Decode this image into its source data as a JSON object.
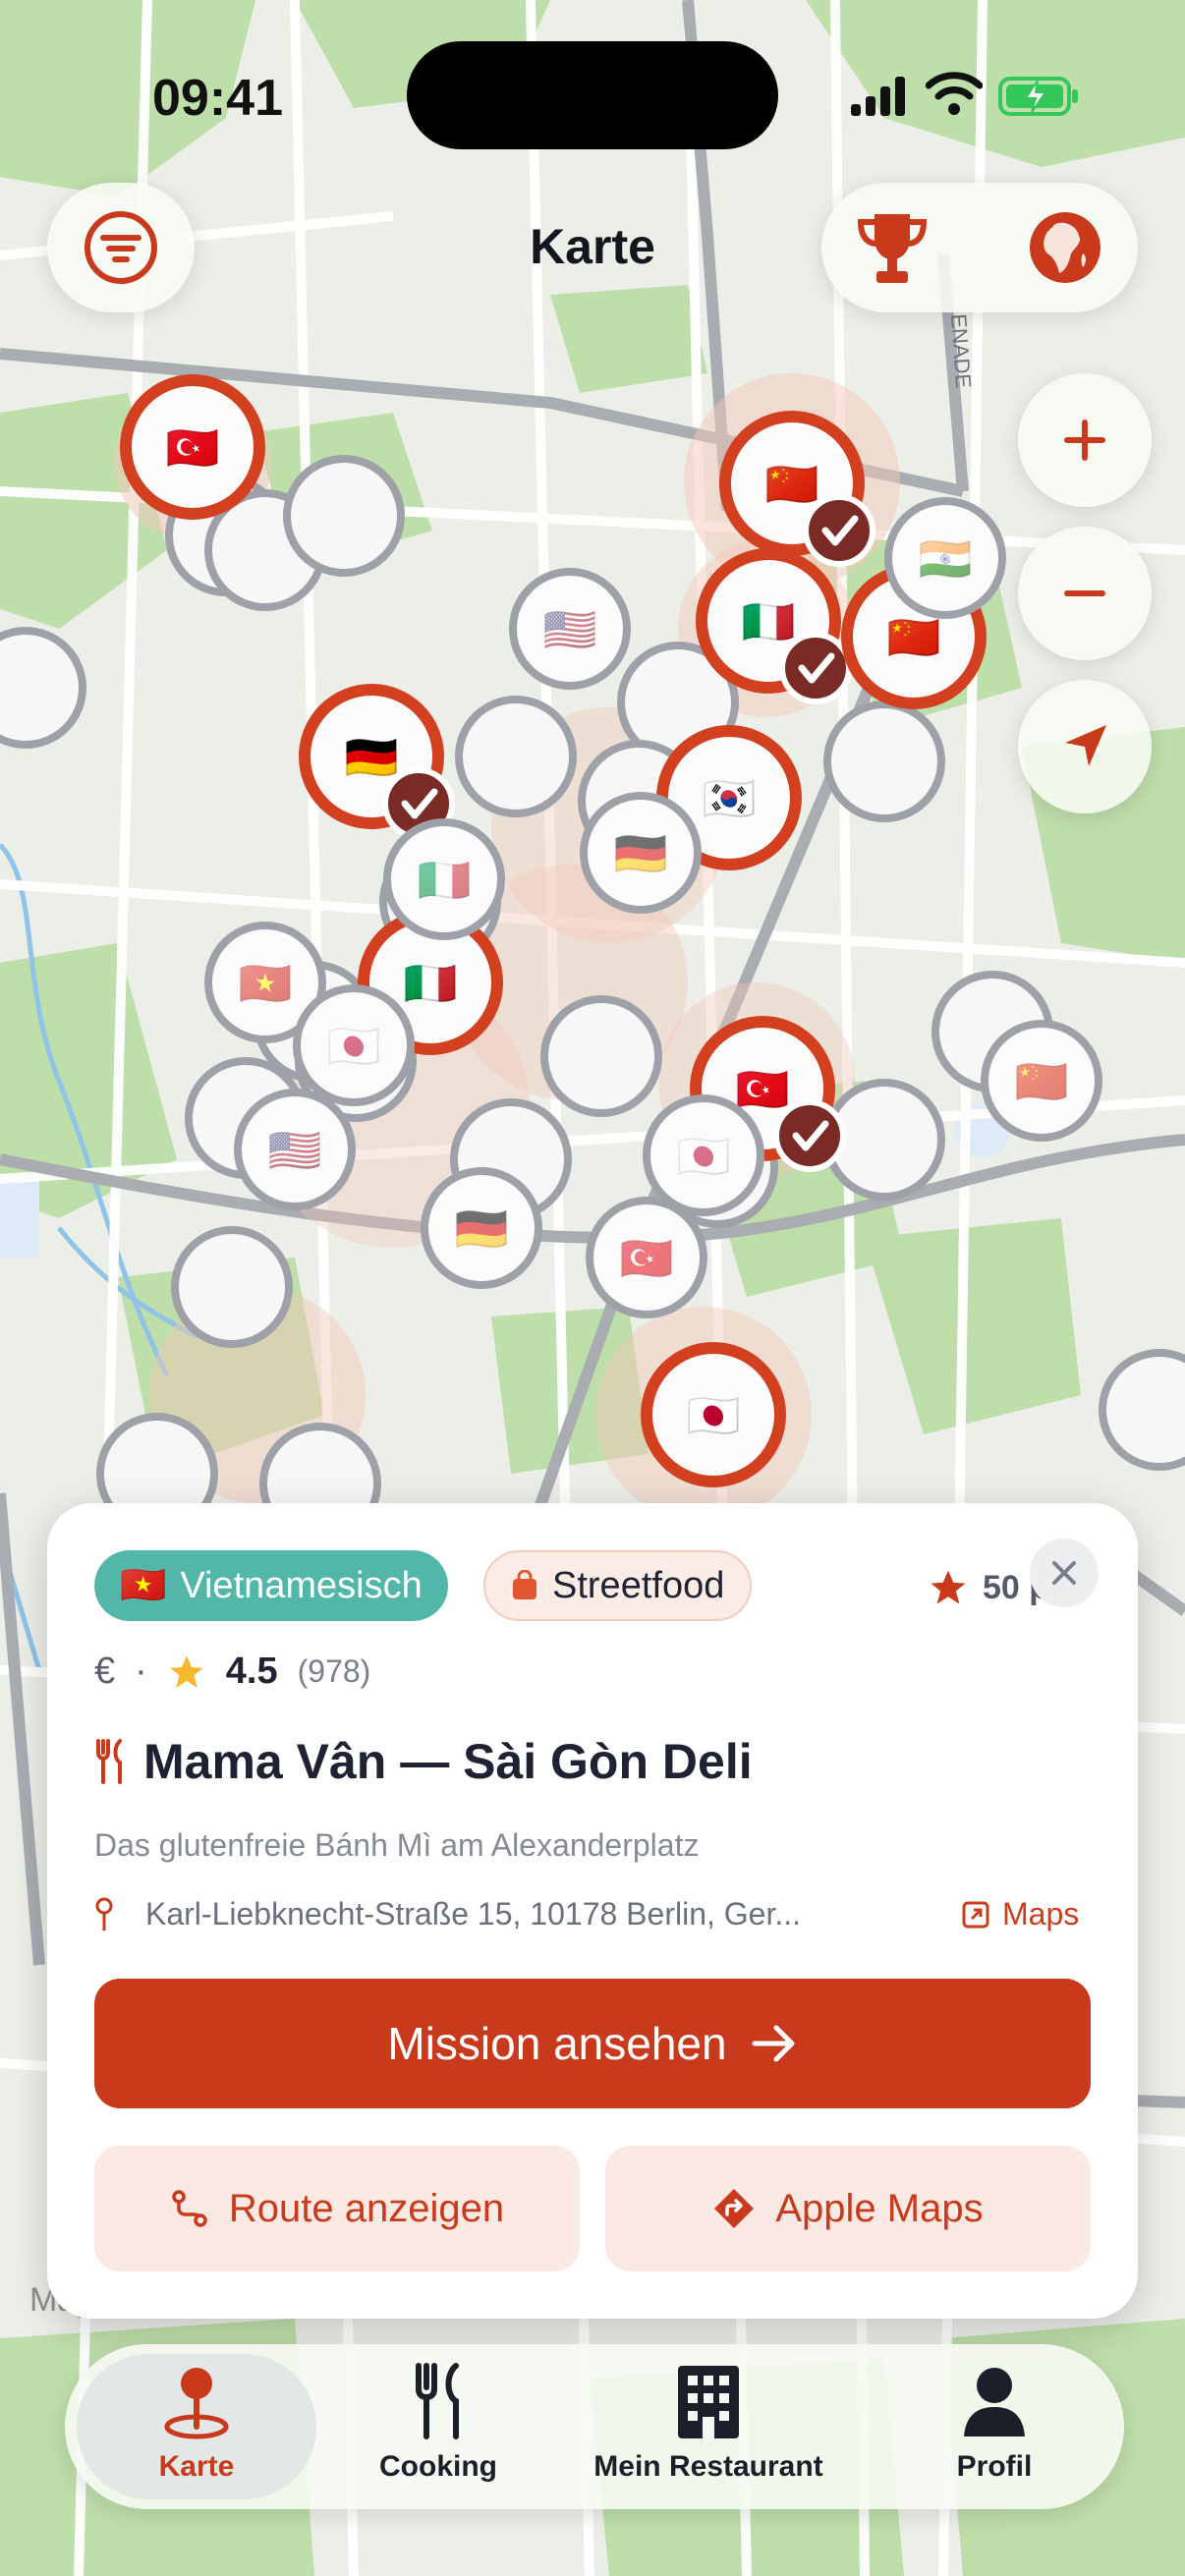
{
  "status_bar": {
    "time": "09:41"
  },
  "header": {
    "title": "Karte"
  },
  "card": {
    "cuisine_flag": "🇻🇳",
    "cuisine": "Vietnamesisch",
    "type": "Streetfood",
    "points": "50 pt",
    "price": "€",
    "separator": "·",
    "rating": "4.5",
    "rating_count": "(978)",
    "name": "Mama Vân — Sài Gòn Deli",
    "description": "Das glutenfreie Bánh Mì am Alexanderplatz",
    "address": "Karl-Liebknecht-Straße 15, 10178 Berlin, Ger...",
    "maps_link": "Maps",
    "cta": "Mission ansehen",
    "route_button": "Route anzeigen",
    "apple_maps_button": "Apple Maps"
  },
  "map_legal": "Maps",
  "tabs": [
    {
      "label": "Karte",
      "icon": "map-pin-icon",
      "active": true
    },
    {
      "label": "Cooking",
      "icon": "fork-knife-icon",
      "active": false
    },
    {
      "label": "Mein Restaurant",
      "icon": "building-icon",
      "active": false
    },
    {
      "label": "Profil",
      "icon": "person-icon",
      "active": false
    }
  ],
  "colors": {
    "accent": "#c93a1c",
    "teal": "#52b6a8",
    "pin_red": "#d2401f",
    "map_green": "#b7dba0"
  },
  "map_pins": [
    {
      "flag": "🇹🇷",
      "completed": false
    },
    {
      "flag": "🇨🇳",
      "completed": true
    },
    {
      "flag": "🇮🇹",
      "completed": true
    },
    {
      "flag": "🇰🇷",
      "completed": false
    },
    {
      "flag": "🇮🇹",
      "completed": false
    },
    {
      "flag": "🇨🇳",
      "completed": false
    },
    {
      "flag": "🇹🇷",
      "completed": true
    },
    {
      "flag": "🇯🇵",
      "completed": false
    },
    {
      "flag": "🇩🇪",
      "completed": true
    },
    {
      "flag": "🇺🇸",
      "completed": false
    },
    {
      "flag": "🇯🇵",
      "completed": false
    },
    {
      "flag": "🇻🇳",
      "completed": false
    },
    {
      "flag": "🇮🇳",
      "completed": false
    },
    {
      "flag": "🇨🇳",
      "completed": false
    },
    {
      "flag": "🇮🇹",
      "completed": false
    },
    {
      "flag": "🇩🇪",
      "completed": false
    },
    {
      "flag": "🇺🇸",
      "completed": false
    },
    {
      "flag": "🇩🇪",
      "completed": false
    },
    {
      "flag": "🇯🇵",
      "completed": false
    },
    {
      "flag": "🇹🇷",
      "completed": false
    }
  ]
}
